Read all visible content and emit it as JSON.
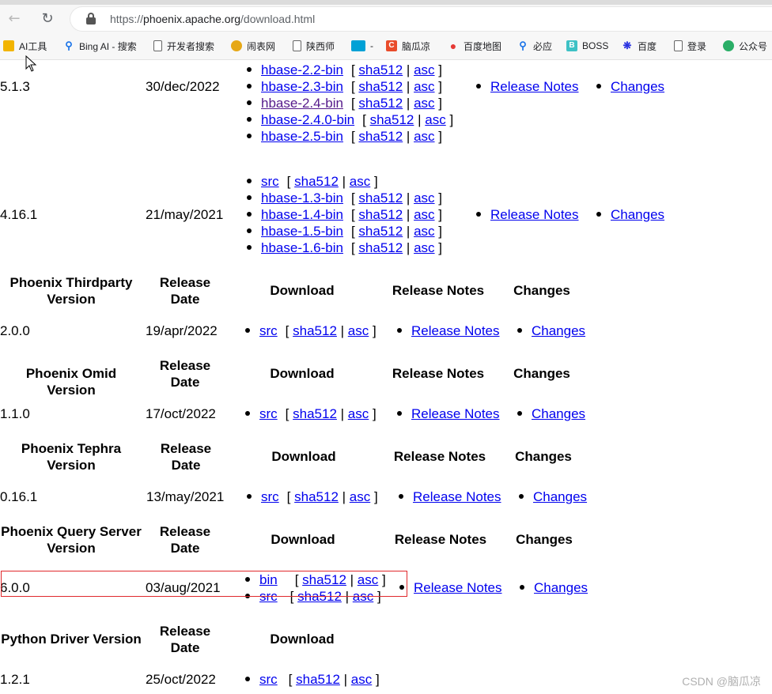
{
  "browser": {
    "url_scheme": "https://",
    "url_host": "phoenix.apache.org",
    "url_path": "/download.html",
    "bookmarks": [
      {
        "label": "AI工具",
        "icon": "folder-icon",
        "color": "#f2b400"
      },
      {
        "label": "Bing AI - 搜索",
        "icon": "search-icon",
        "color": "#1a73e8"
      },
      {
        "label": "开发者搜索",
        "icon": "page-icon",
        "color": "#ffffff"
      },
      {
        "label": "闹表网",
        "icon": "alarm-icon",
        "color": "#e6a817"
      },
      {
        "label": "陕西师",
        "icon": "page-icon",
        "color": "#ffffff"
      },
      {
        "label": "-",
        "icon": "bilibili-icon",
        "color": "#00a1d6"
      },
      {
        "label": "脑瓜凉",
        "icon": "csdn-icon",
        "color": "#e94c2b"
      },
      {
        "label": "百度地图",
        "icon": "map-pin-icon",
        "color": "#e53935"
      },
      {
        "label": "必应",
        "icon": "search-icon",
        "color": "#1a73e8"
      },
      {
        "label": "BOSS",
        "icon": "boss-icon",
        "color": "#3ec1c5"
      },
      {
        "label": "百度",
        "icon": "paw-icon",
        "color": "#2932e1"
      },
      {
        "label": "登录",
        "icon": "page-icon",
        "color": "#ffffff"
      },
      {
        "label": "公众号",
        "icon": "wechat-icon",
        "color": "#2aae67"
      }
    ]
  },
  "phoenix_releases": {
    "v513": {
      "version": "5.1.3",
      "date": "30/dec/2022",
      "downloads": [
        {
          "name": "hbase-2.2-bin",
          "sha": "sha512",
          "asc": "asc"
        },
        {
          "name": "hbase-2.3-bin",
          "sha": "sha512",
          "asc": "asc"
        },
        {
          "name": "hbase-2.4-bin",
          "sha": "sha512",
          "asc": "asc"
        },
        {
          "name": "hbase-2.4.0-bin",
          "sha": "sha512",
          "asc": "asc"
        },
        {
          "name": "hbase-2.5-bin",
          "sha": "sha512",
          "asc": "asc"
        }
      ],
      "release_notes": "Release Notes",
      "changes": "Changes"
    },
    "v4161": {
      "version": "4.16.1",
      "date": "21/may/2021",
      "downloads": [
        {
          "name": "src",
          "sha": "sha512",
          "asc": "asc"
        },
        {
          "name": "hbase-1.3-bin",
          "sha": "sha512",
          "asc": "asc"
        },
        {
          "name": "hbase-1.4-bin",
          "sha": "sha512",
          "asc": "asc"
        },
        {
          "name": "hbase-1.5-bin",
          "sha": "sha512",
          "asc": "asc"
        },
        {
          "name": "hbase-1.6-bin",
          "sha": "sha512",
          "asc": "asc"
        }
      ],
      "release_notes": "Release Notes",
      "changes": "Changes"
    }
  },
  "thirdparty": {
    "headers": {
      "version": "Phoenix Thirdparty Version",
      "date": "Release Date",
      "download": "Download",
      "notes": "Release Notes",
      "changes": "Changes"
    },
    "version": "2.0.0",
    "date": "19/apr/2022",
    "src": "src",
    "sha": "sha512",
    "asc": "asc",
    "release_notes": "Release Notes",
    "changes_link": "Changes"
  },
  "omid": {
    "headers": {
      "version": "Phoenix Omid Version",
      "date": "Release Date",
      "download": "Download",
      "notes": "Release Notes",
      "changes": "Changes"
    },
    "version": "1.1.0",
    "date": "17/oct/2022",
    "src": "src",
    "sha": "sha512",
    "asc": "asc",
    "release_notes": "Release Notes",
    "changes_link": "Changes"
  },
  "tephra": {
    "headers": {
      "version": "Phoenix Tephra Version",
      "date": "Release Date",
      "download": "Download",
      "notes": "Release Notes",
      "changes": "Changes"
    },
    "version": "0.16.1",
    "date": "13/may/2021",
    "src": "src",
    "sha": "sha512",
    "asc": "asc",
    "release_notes": "Release Notes",
    "changes_link": "Changes"
  },
  "queryserver": {
    "headers": {
      "version": "Phoenix Query Server Version",
      "date": "Release Date",
      "download": "Download",
      "notes": "Release Notes",
      "changes": "Changes"
    },
    "version": "6.0.0",
    "date": "03/aug/2021",
    "bin": "bin",
    "src": "src",
    "sha": "sha512",
    "asc": "asc",
    "release_notes": "Release Notes",
    "changes_link": "Changes"
  },
  "python": {
    "headers": {
      "version": "Python Driver Version",
      "date": "Release Date",
      "download": "Download"
    },
    "version": "1.2.1",
    "date": "25/oct/2022",
    "src": "src",
    "sha": "sha512",
    "asc": "asc"
  },
  "watermark": "CSDN @脑瓜凉"
}
